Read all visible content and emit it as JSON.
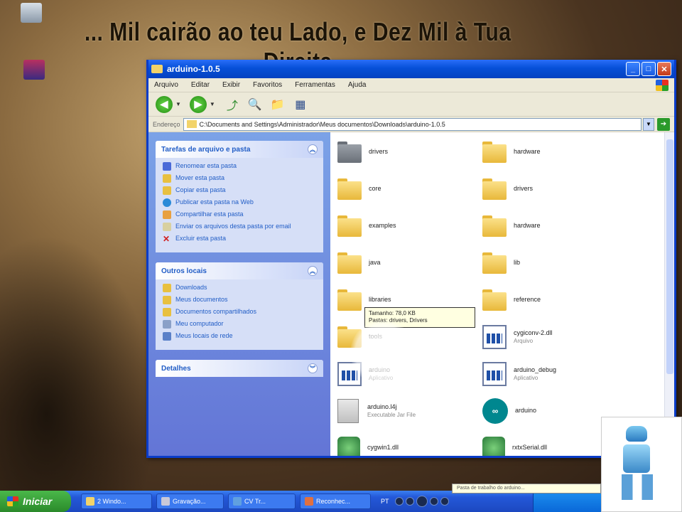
{
  "banner": "... Mil cairão ao teu Lado, e Dez Mil à Tua Direita",
  "window": {
    "title": "arduino-1.0.5",
    "menu": [
      "Arquivo",
      "Editar",
      "Exibir",
      "Favoritos",
      "Ferramentas",
      "Ajuda"
    ],
    "address_label": "Endereço",
    "address": "C:\\Documents and Settings\\Administrador\\Meus documentos\\Downloads\\arduino-1.0.5"
  },
  "tasks_panel": {
    "title": "Tarefas de arquivo e pasta",
    "items": [
      "Renomear esta pasta",
      "Mover esta pasta",
      "Copiar esta pasta",
      "Publicar esta pasta na Web",
      "Compartilhar esta pasta",
      "Enviar os arquivos desta pasta por email",
      "Excluir esta pasta"
    ]
  },
  "places_panel": {
    "title": "Outros locais",
    "items": [
      "Downloads",
      "Meus documentos",
      "Documentos compartilhados",
      "Meu computador",
      "Meus locais de rede"
    ]
  },
  "details_panel": {
    "title": "Detalhes"
  },
  "files": [
    {
      "name": "drivers",
      "type": "folder-gray"
    },
    {
      "name": "hardware",
      "type": "folder"
    },
    {
      "name": "core",
      "type": "folder"
    },
    {
      "name": "drivers",
      "type": "folder"
    },
    {
      "name": "examples",
      "type": "folder"
    },
    {
      "name": "hardware",
      "type": "folder"
    },
    {
      "name": "java",
      "type": "folder"
    },
    {
      "name": "lib",
      "type": "folder"
    },
    {
      "name": "libraries",
      "type": "folder"
    },
    {
      "name": "reference",
      "type": "folder"
    },
    {
      "name": "tools",
      "type": "folder"
    },
    {
      "name": "cygiconv-2.dll",
      "type": "exe",
      "meta": "Arquivo"
    },
    {
      "name": "arduino",
      "type": "exe",
      "meta": "Aplicativo"
    },
    {
      "name": "arduino_debug",
      "type": "exe",
      "meta": "Aplicativo"
    },
    {
      "name": "arduino.l4j",
      "type": "jar",
      "meta": "Executable Jar File"
    },
    {
      "name": "arduino",
      "type": "arduino"
    },
    {
      "name": "cygwin1.dll",
      "type": "dll"
    },
    {
      "name": "rxtxSerial.dll",
      "type": "dll"
    }
  ],
  "tooltip": "Tamanho: 78,0 KB\nPastas: drivers, Drivers",
  "taskbar": {
    "start": "Iniciar",
    "buttons": [
      "2 Windo...",
      "Gravação...",
      "CV Tr...",
      "Reconhec..."
    ],
    "lang": "PT",
    "balloon": "Pasta de trabalho do arduino..."
  }
}
